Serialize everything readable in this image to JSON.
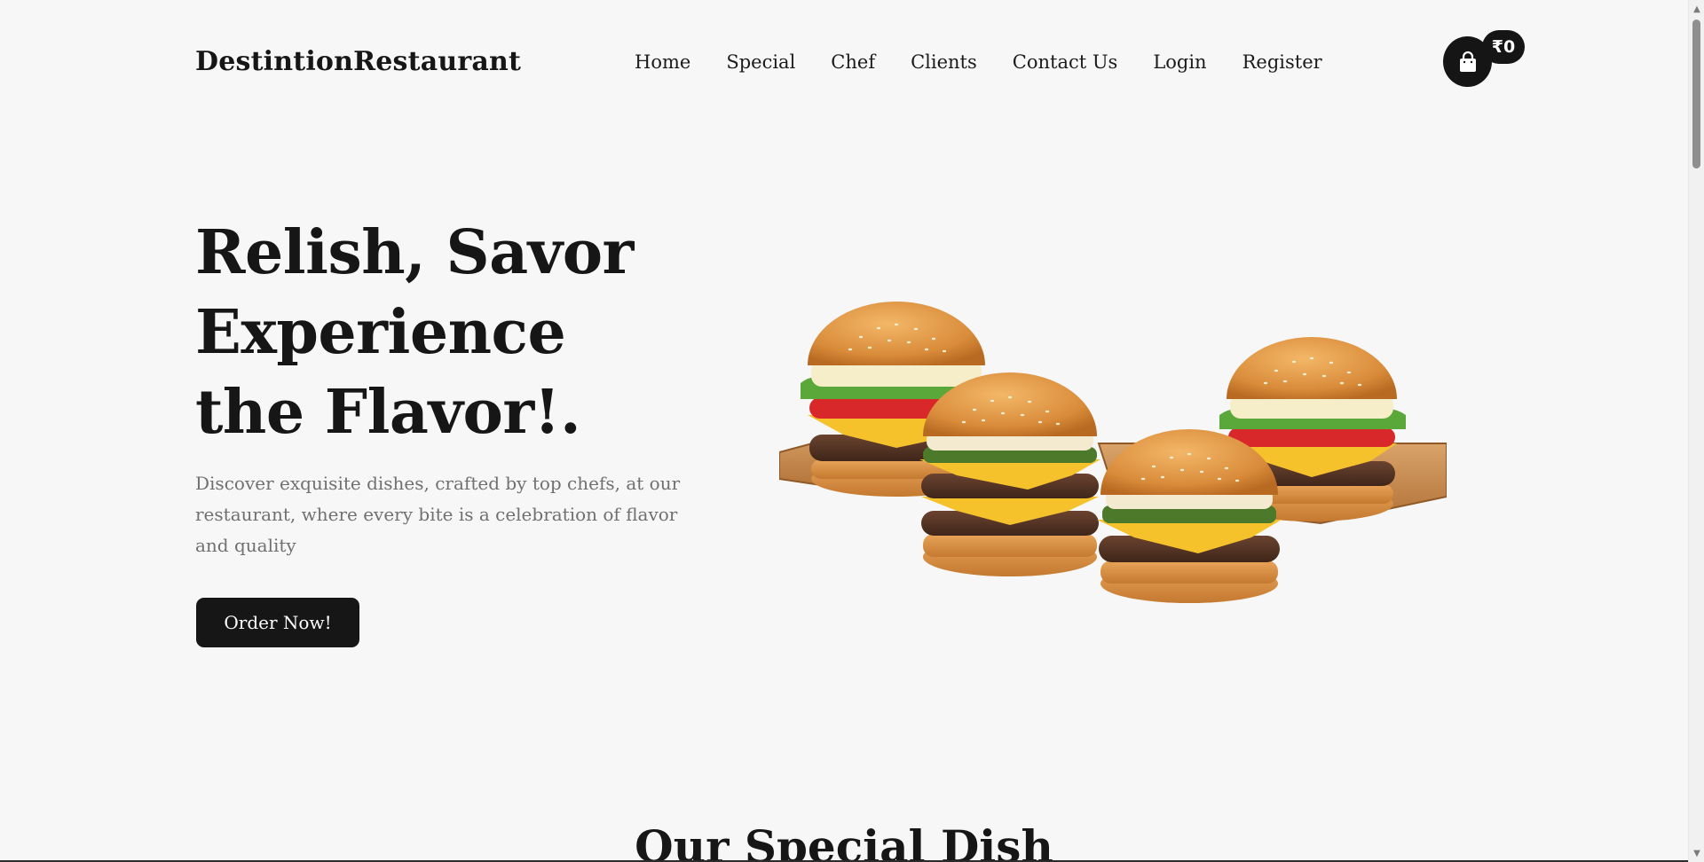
{
  "header": {
    "brand": "DestintionRestaurant",
    "nav": [
      {
        "label": "Home"
      },
      {
        "label": "Special"
      },
      {
        "label": "Chef"
      },
      {
        "label": "Clients"
      },
      {
        "label": "Contact Us"
      },
      {
        "label": "Login"
      },
      {
        "label": "Register"
      }
    ],
    "cart": {
      "icon": "shopping-bag-icon",
      "total": "₹0"
    }
  },
  "hero": {
    "title_lines": [
      "Relish, Savor",
      "Experience",
      "the Flavor!."
    ],
    "description": "Discover exquisite dishes, crafted by top chefs, at our restaurant, where every bite is a celebration of flavor and quality",
    "cta_label": "Order Now!",
    "image": "burgers-on-wooden-boards"
  },
  "sections": {
    "special_title": "Our Special Dish"
  },
  "colors": {
    "background": "#f7f7f7",
    "text": "#161616",
    "muted_text": "#707070",
    "button": "#161616"
  }
}
